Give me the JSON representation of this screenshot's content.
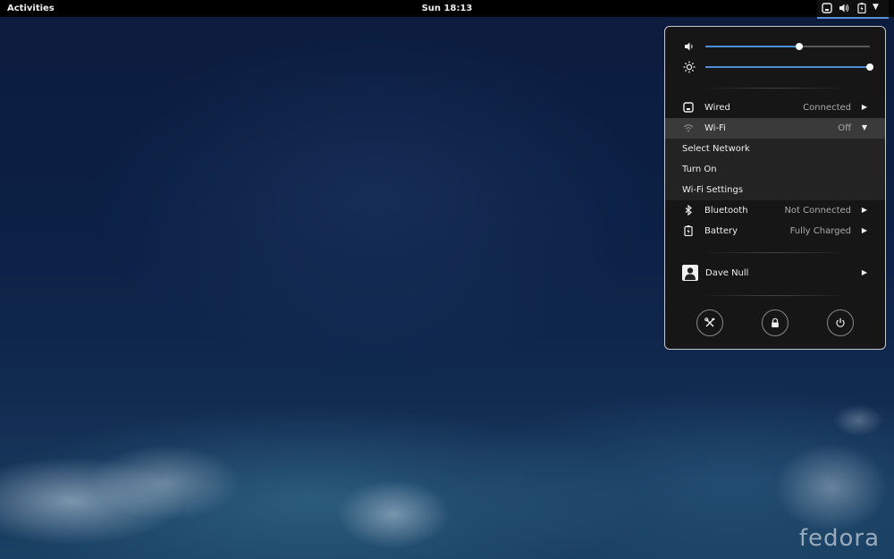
{
  "topbar": {
    "activities": "Activities",
    "clock": "Sun 18:13"
  },
  "sliders": {
    "volume": 0.57,
    "brightness": 1.0
  },
  "network": {
    "wired": {
      "label": "Wired",
      "status": "Connected"
    },
    "wifi": {
      "label": "Wi-Fi",
      "status": "Off",
      "submenu": [
        "Select Network",
        "Turn On",
        "Wi-Fi Settings"
      ]
    },
    "bluetooth": {
      "label": "Bluetooth",
      "status": "Not Connected"
    },
    "battery": {
      "label": "Battery",
      "status": "Fully Charged"
    }
  },
  "user": {
    "name": "Dave Null"
  },
  "branding": {
    "logo_text": "fedora"
  },
  "colors": {
    "accent": "#4a90d9",
    "panel": "#161616",
    "topbar": "#000000"
  }
}
